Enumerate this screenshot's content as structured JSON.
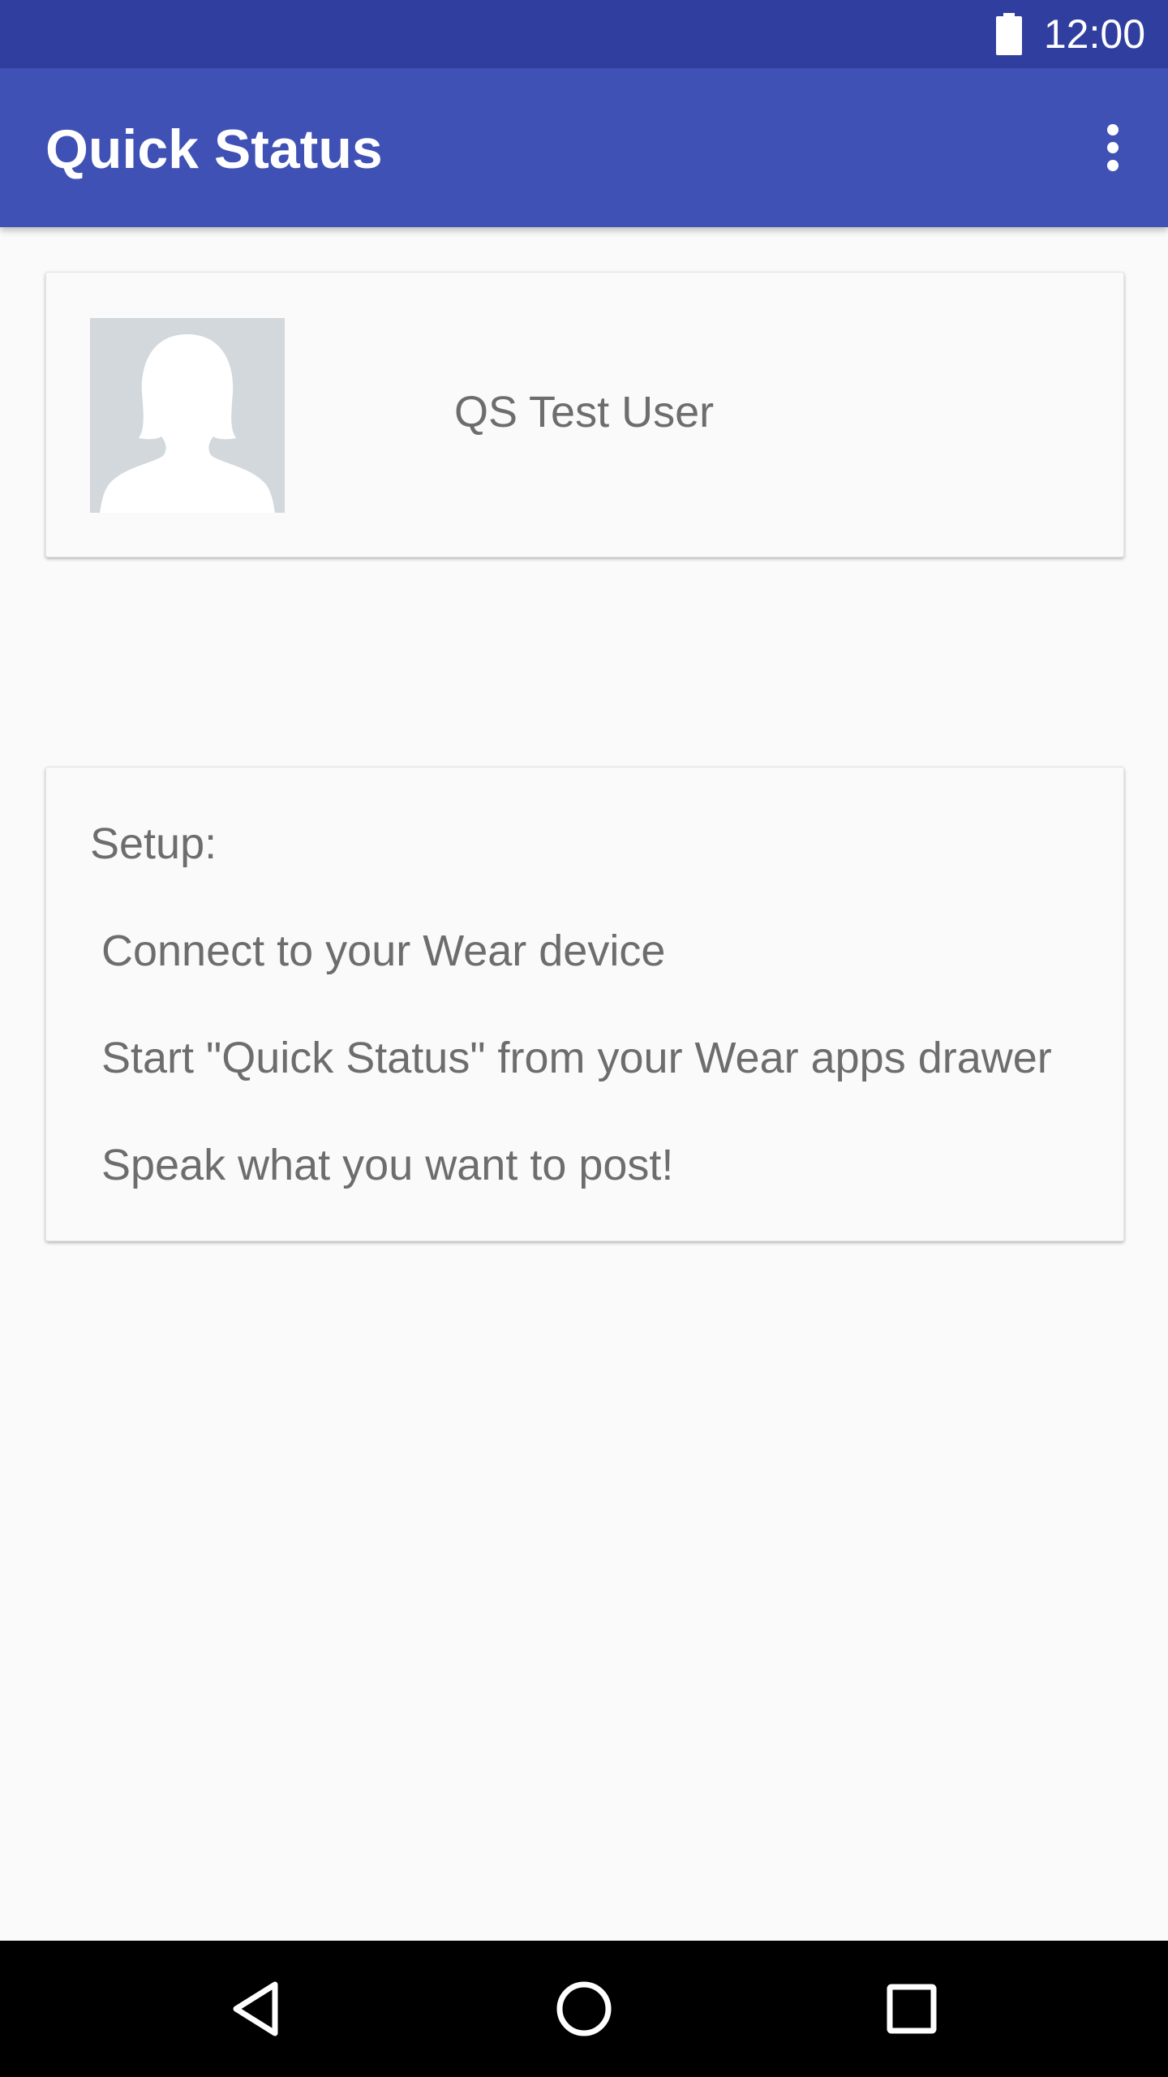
{
  "status_bar": {
    "time": "12:00",
    "battery_icon": "battery-full-icon"
  },
  "app_bar": {
    "title": "Quick Status",
    "menu_icon": "more-vert-icon"
  },
  "profile": {
    "avatar_icon": "default-avatar-icon",
    "name": "QS Test User"
  },
  "setup": {
    "title": "Setup:",
    "steps": [
      "Connect to your Wear device",
      "Start \"Quick Status\" from your Wear apps drawer",
      "Speak what you want to post!"
    ]
  },
  "nav_bar": {
    "back_icon": "back-icon",
    "home_icon": "home-icon",
    "recents_icon": "recents-icon"
  },
  "colors": {
    "primary": "#3f51b5",
    "primary_dark": "#303f9f",
    "background": "#fafafa",
    "text_secondary": "#6d6d6d"
  }
}
